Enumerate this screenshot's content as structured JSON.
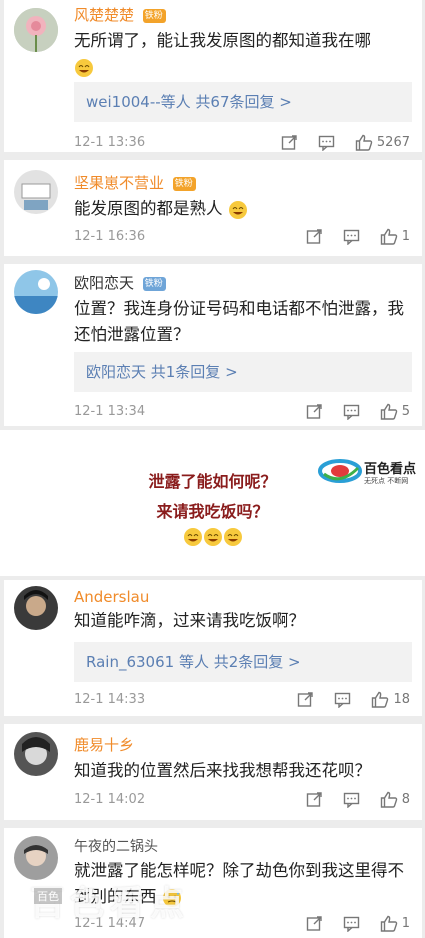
{
  "comments": [
    {
      "username": "风楚楚楚",
      "badge": "铁粉",
      "text": "无所谓了，能让我发原图的都知道我在哪",
      "reply_summary": "wei1004--等人 共67条回复 >",
      "timestamp": "12-1 13:36",
      "like_count": "5267"
    },
    {
      "username": "坚果崽不营业",
      "badge": "铁粉",
      "text": "能发原图的都是熟人",
      "timestamp": "12-1 16:36",
      "like_count": "1"
    },
    {
      "username": "欧阳恋天",
      "badge": "铁粉",
      "text": "位置？我连身份证号码和电话都不怕泄露，我还怕泄露位置？",
      "reply_summary": "欧阳恋天 共1条回复 >",
      "timestamp": "12-1 13:34",
      "like_count": "5"
    },
    {
      "username": "Anderslau",
      "text": "知道能咋滴，过来请我吃饭啊？",
      "reply_summary": "Rain_63061 等人 共2条回复 >",
      "timestamp": "12-1 14:33",
      "like_count": "18"
    },
    {
      "username": "鹿易十乡",
      "text": "知道我的位置然后来找我想帮我还花呗？",
      "timestamp": "12-1 14:02",
      "like_count": "8"
    },
    {
      "username": "午夜的二锅头",
      "text": "就泄露了能怎样呢？除了劫色你到我这里得不到别的东西",
      "timestamp": "12-1 14:47",
      "like_count": "1"
    }
  ],
  "caption": {
    "line1": "泄露了能如何呢？",
    "line2": "来请我吃饭吗？"
  },
  "logo": {
    "name": "百色看点",
    "slogan": "无死点 不断网"
  },
  "watermark": {
    "text": "百色看点",
    "small": "百色"
  },
  "colors": {
    "username_vip": "#f08b2a",
    "reply_link": "#5b7fb3",
    "caption": "#8a1c1c"
  },
  "icons": [
    "share-icon",
    "comment-icon",
    "like-icon",
    "laugh-emoji"
  ]
}
